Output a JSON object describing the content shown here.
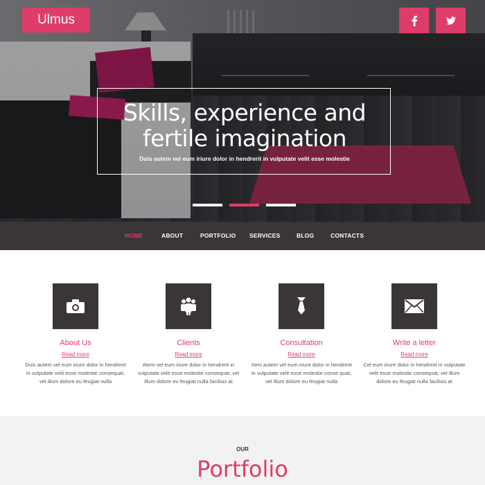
{
  "brand": {
    "logo": "Ulmus",
    "accent": "#de3d6a",
    "dark": "#3a3538"
  },
  "social": [
    {
      "icon": "facebook-icon",
      "label": "f"
    },
    {
      "icon": "twitter-icon"
    }
  ],
  "hero": {
    "title_line1": "Skills, experience and",
    "title_line2": "fertile imagination",
    "subtitle": "Duis autem vel eum iriure dolor in hendrerit in vulputate velit esse molestie",
    "slides": 3,
    "active_slide": 2
  },
  "nav": {
    "items": [
      {
        "label": "HOME",
        "active": true
      },
      {
        "label": "ABOUT",
        "active": false
      },
      {
        "label": "PORTFOLIO",
        "active": false
      },
      {
        "label": "SERVICES",
        "active": false
      },
      {
        "label": "BLOG",
        "active": false
      },
      {
        "label": "CONTACTS",
        "active": false
      }
    ]
  },
  "features": [
    {
      "icon": "camera-icon",
      "title": "About Us",
      "more": "Read more",
      "text_line1": "Duis autem vel eum iriure dolor in hendrerit",
      "text_line2": "in vulputate velit esse molestie consequat,",
      "text_line3": "vel illum dolore eu feugiat nulla"
    },
    {
      "icon": "people-icon",
      "title": "Clients",
      "more": "Read more",
      "text_line1": "Atem vel eum iriure dolor in hendrerit in",
      "text_line2": "vulputate velit esse molestie consequat, vel",
      "text_line3": "illum dolore eu feugiat nulla facilisis at"
    },
    {
      "icon": "tie-icon",
      "title": "Consultation",
      "more": "Read more",
      "text_line1": "Xers autem vel eum iriure dolor in hendrerit",
      "text_line2": "in vulputate velit esse molestie conse quat,",
      "text_line3": "vel illum dolore eu feugiat nulla"
    },
    {
      "icon": "envelope-icon",
      "title": "Write a letter",
      "more": "Read more",
      "text_line1": "Cel eum iriure dolor in hendrerit in vulputate",
      "text_line2": "velit esse molestie consequat, vel illum",
      "text_line3": "dolore eu feugiat nulla facilisis at"
    }
  ],
  "portfolio": {
    "kicker": "OUR",
    "title": "Portfolio"
  }
}
